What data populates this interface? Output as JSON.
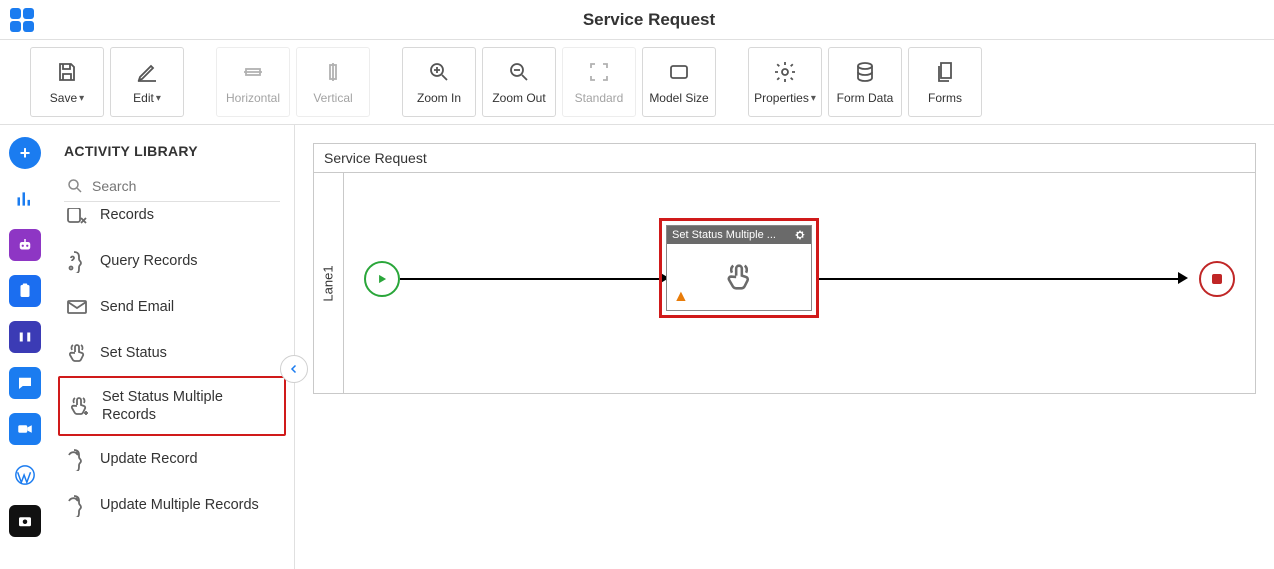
{
  "header": {
    "title": "Service Request"
  },
  "toolbar": {
    "save": "Save",
    "edit": "Edit",
    "horizontal": "Horizontal",
    "vertical": "Vertical",
    "zoom_in": "Zoom In",
    "zoom_out": "Zoom Out",
    "standard": "Standard",
    "model_size": "Model Size",
    "properties": "Properties",
    "form_data": "Form Data",
    "forms": "Forms"
  },
  "library": {
    "title": "ACTIVITY LIBRARY",
    "search_placeholder": "Search",
    "items": [
      {
        "label": "Records",
        "icon": "records-x"
      },
      {
        "label": "Query Records",
        "icon": "query"
      },
      {
        "label": "Send Email",
        "icon": "mail"
      },
      {
        "label": "Set Status",
        "icon": "tap"
      },
      {
        "label": "Set Status Multiple Records",
        "icon": "tap-plus",
        "highlight": true
      },
      {
        "label": "Update Record",
        "icon": "refresh"
      },
      {
        "label": "Update Multiple Records",
        "icon": "refresh"
      }
    ]
  },
  "canvas": {
    "pool_title": "Service Request",
    "lane_label": "Lane1",
    "activity": {
      "title": "Set Status Multiple ..."
    }
  }
}
